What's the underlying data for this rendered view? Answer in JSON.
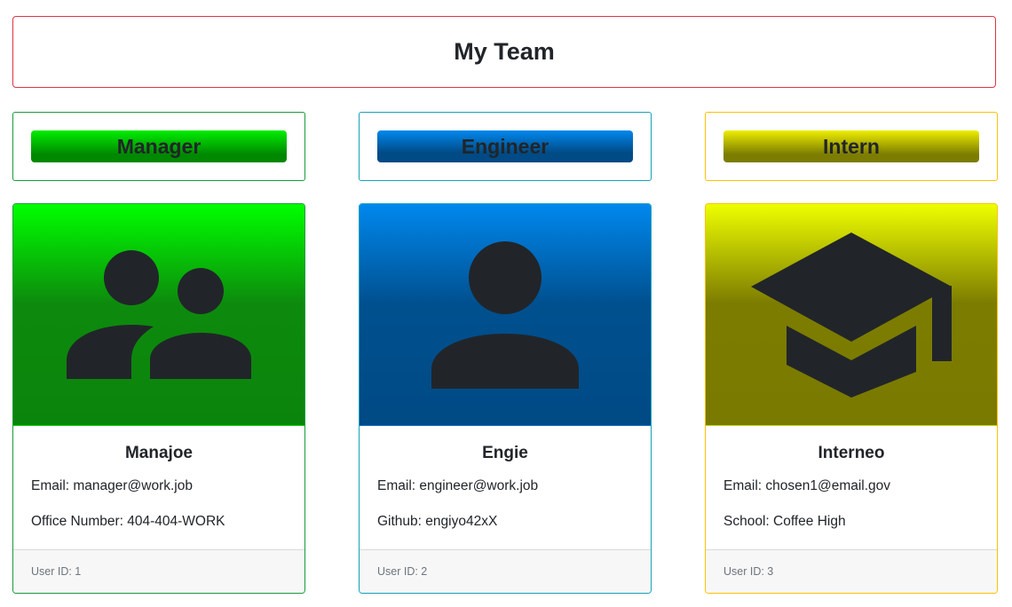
{
  "header": {
    "title": "My Team"
  },
  "colors": {
    "header_border": "#dc3545",
    "manager": "#1a9b3c",
    "engineer": "#17a2b8",
    "intern": "#ffc107",
    "icon": "#212529"
  },
  "roles": [
    {
      "label": "Manager"
    },
    {
      "label": "Engineer"
    },
    {
      "label": "Intern"
    }
  ],
  "cards": [
    {
      "icon": "people-icon",
      "name": "Manajoe",
      "line1": "Email: manager@work.job",
      "line2": "Office Number: 404-404-WORK",
      "footer": "User ID: 1"
    },
    {
      "icon": "person-icon",
      "name": "Engie",
      "line1": "Email: engineer@work.job",
      "line2": "Github: engiyo42xX",
      "footer": "User ID: 2"
    },
    {
      "icon": "graduation-cap-icon",
      "name": "Interneo",
      "line1": "Email: chosen1@email.gov",
      "line2": "School: Coffee High",
      "footer": "User ID: 3"
    }
  ]
}
